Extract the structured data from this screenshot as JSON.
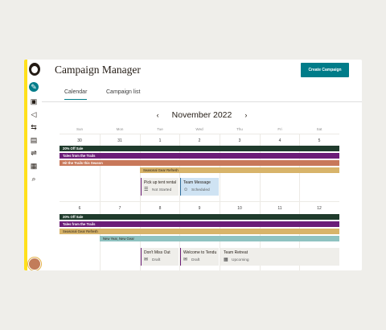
{
  "header": {
    "title": "Campaign Manager",
    "create_button": "Create Campaign"
  },
  "tabs": [
    {
      "label": "Calendar",
      "active": true
    },
    {
      "label": "Campaign list",
      "active": false
    }
  ],
  "calendar": {
    "month_label": "November 2022",
    "prev_icon": "chevron-left-icon",
    "next_icon": "chevron-right-icon",
    "weekdays": [
      "Sun",
      "Mon",
      "Tue",
      "Wed",
      "Thu",
      "Fri",
      "Sat"
    ],
    "weeks": [
      {
        "dates": [
          "30",
          "31",
          "1",
          "2",
          "3",
          "4",
          "5"
        ],
        "bars": [
          {
            "label": "20% Off Sale",
            "color": "#1f3b2c"
          },
          {
            "label": "Tales from the Trails",
            "color": "#6b1d78"
          },
          {
            "label": "Hit the Trails this Season",
            "color": "#c8785a"
          },
          {
            "label": "Seasonal Gear Refresh",
            "color": "#d8b46a"
          }
        ],
        "cards": [
          {
            "title": "Pick up tent rental",
            "status": "Not Started",
            "icon": "list-icon"
          },
          {
            "title": "Team Message",
            "status": "Scheduled",
            "icon": "people-icon"
          }
        ]
      },
      {
        "dates": [
          "6",
          "7",
          "8",
          "9",
          "10",
          "11",
          "12"
        ],
        "bars": [
          {
            "label": "20% Off Sale",
            "color": "#1f3b2c"
          },
          {
            "label": "Tales from the Trails",
            "color": "#6b1d78"
          },
          {
            "label": "Seasonal Gear Refresh",
            "color": "#d8b46a"
          },
          {
            "label": "New Year, New Gear",
            "color": "#8fc3c1"
          }
        ],
        "cards": [
          {
            "title": "Don't Miss Out",
            "status": "Draft",
            "icon": "email-icon"
          },
          {
            "title": "Welcome to Tendu",
            "status": "Draft",
            "icon": "email-icon"
          },
          {
            "title": "Team Retreat",
            "status": "Upcoming",
            "icon": "calendar-icon"
          }
        ]
      }
    ]
  },
  "colors": {
    "accent": "#007c89",
    "rail": "#ffe01b",
    "scheduled_card": "#cfe3f3"
  }
}
